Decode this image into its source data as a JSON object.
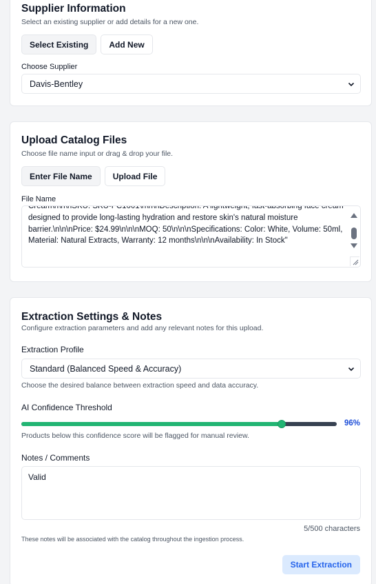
{
  "supplier": {
    "title": "Supplier Information",
    "subtitle": "Select an existing supplier or add details for a new one.",
    "btn_existing": "Select Existing",
    "btn_new": "Add New",
    "choose_label": "Choose Supplier",
    "selected": "Davis-Bentley"
  },
  "catalog": {
    "title": "Upload Catalog Files",
    "subtitle": "Choose file name input or drag & drop your file.",
    "btn_enter": "Enter File Name",
    "btn_upload": "Upload File",
    "file_label": "File Name",
    "file_value": "Cream\\n\\n\\nSKU: SKU-FC1001\\n\\n\\nDescription: A lightweight, fast-absorbing face cream designed to provide long-lasting hydration and restore skin's natural moisture barrier.\\n\\n\\nPrice: $24.99\\n\\n\\nMOQ: 50\\n\\n\\nSpecifications: Color: White, Volume: 50ml, Material: Natural Extracts, Warranty: 12 months\\n\\n\\nAvailability: In Stock\""
  },
  "extraction": {
    "title": "Extraction Settings & Notes",
    "subtitle": "Configure extraction parameters and add any relevant notes for this upload.",
    "profile_label": "Extraction Profile",
    "profile_selected": "Standard (Balanced Speed & Accuracy)",
    "profile_help": "Choose the desired balance between extraction speed and data accuracy.",
    "threshold_label": "AI Confidence Threshold",
    "threshold_value": 96,
    "threshold_display": "96%",
    "threshold_help": "Products below this confidence score will be flagged for manual review.",
    "notes_label": "Notes / Comments",
    "notes_value": "Valid",
    "counter": "5/500 characters",
    "notes_help": "These notes will be associated with the catalog throughout the ingestion process.",
    "start_label": "Start Extraction"
  },
  "colors": {
    "accent": "#2563eb",
    "slider": "#22b573"
  }
}
